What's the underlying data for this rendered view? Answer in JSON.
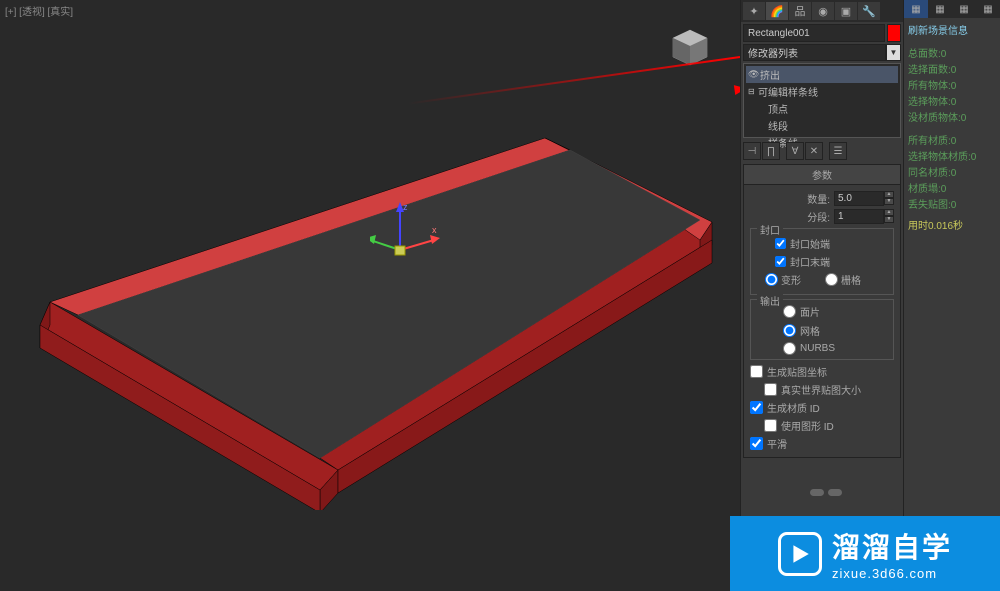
{
  "viewport": {
    "label": "[+] [透视] [真实]"
  },
  "gizmo": {
    "x": "x",
    "y": "y",
    "z": "z"
  },
  "panel": {
    "object_name": "Rectangle001",
    "modifier_list_label": "修改器列表",
    "stack": {
      "extrude": "挤出",
      "editable_spline": "可编辑样条线",
      "vertex": "顶点",
      "segment": "线段",
      "spline": "样条线"
    },
    "rollout_params": "参数",
    "amount_label": "数量:",
    "amount_value": "5.0",
    "segments_label": "分段:",
    "segments_value": "1",
    "cap_group": "封口",
    "cap_start": "封口始端",
    "cap_end": "封口末端",
    "morph": "变形",
    "grid": "栅格",
    "output_group": "输出",
    "patch": "面片",
    "mesh": "网格",
    "nurbs": "NURBS",
    "gen_mapping": "生成贴图坐标",
    "real_world": "真实世界贴图大小",
    "gen_material": "生成材质 ID",
    "use_shape": "使用图形 ID",
    "smooth": "平滑"
  },
  "stats": {
    "header": "刷新场景信息",
    "total_faces": "总面数:0",
    "sel_faces": "选择面数:0",
    "all_objects": "所有物体:0",
    "sel_objects": "选择物体:0",
    "no_mat_objects": "没材质物体:0",
    "all_materials": "所有材质:0",
    "sel_obj_mat": "选择物体材质:0",
    "same_mat": "同名材质:0",
    "mat_loss": "材质塌:0",
    "miss_map": "丢失贴图:0",
    "time": "用时0.016秒"
  },
  "watermark": {
    "main": "溜溜自学",
    "sub": "zixue.3d66.com"
  }
}
